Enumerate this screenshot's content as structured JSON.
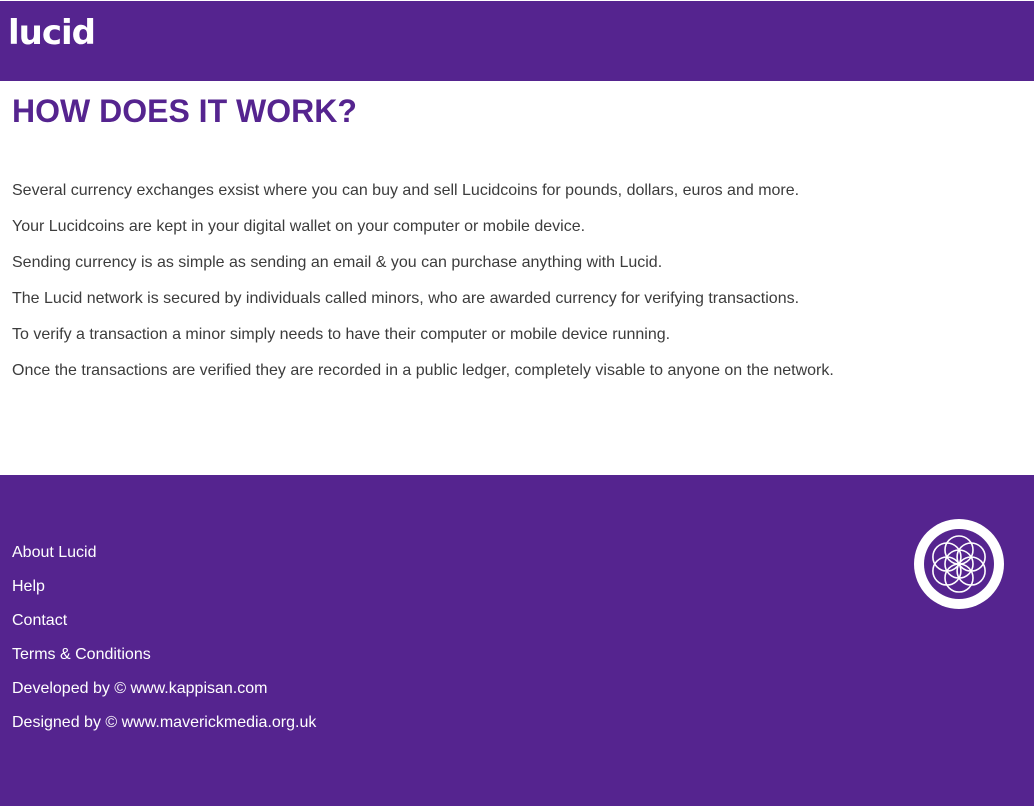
{
  "header": {
    "logo_text": "lucid",
    "background_color": "#55248f"
  },
  "main": {
    "title": "HOW DOES IT WORK?",
    "title_color": "#55248f",
    "paragraphs": [
      "Several currency exchanges exsist where you can buy and sell Lucidcoins for pounds, dollars, euros and more.",
      "Your Lucidcoins are kept in your digital wallet on your computer or mobile device.",
      "Sending currency is as simple as sending an email & you can purchase anything with Lucid.",
      "The Lucid network is secured by individuals called minors, who are awarded currency for verifying transactions.",
      "To verify a transaction a minor simply needs to have their computer or mobile device running.",
      "Once the transactions are verified they are recorded in a public ledger, completely visable to anyone on the network."
    ]
  },
  "footer": {
    "background_color": "#55248f",
    "links": [
      "About Lucid",
      "Help",
      "Contact",
      "Terms & Conditions",
      "Developed by © www.kappisan.com",
      "Designed by © www.maverickmedia.org.uk"
    ],
    "emblem_icon": "flower-of-life-icon"
  }
}
